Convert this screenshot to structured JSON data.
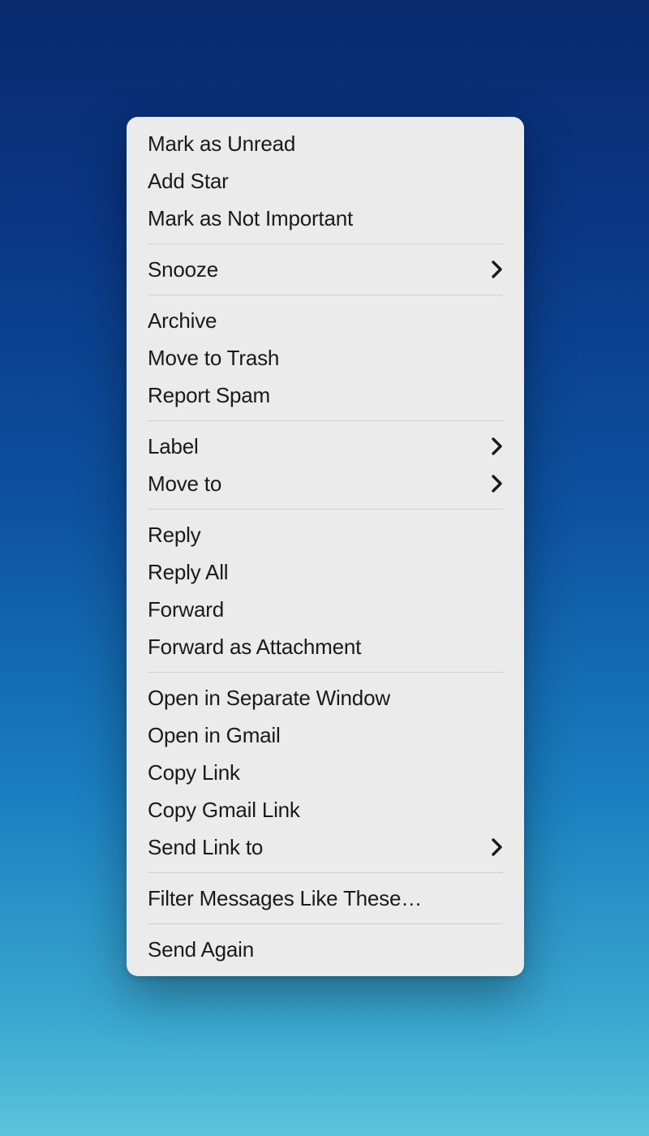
{
  "menu": {
    "groups": [
      [
        {
          "label": "Mark as Unread",
          "submenu": false
        },
        {
          "label": "Add Star",
          "submenu": false
        },
        {
          "label": "Mark as Not Important",
          "submenu": false
        }
      ],
      [
        {
          "label": "Snooze",
          "submenu": true
        }
      ],
      [
        {
          "label": "Archive",
          "submenu": false
        },
        {
          "label": "Move to Trash",
          "submenu": false
        },
        {
          "label": "Report Spam",
          "submenu": false
        }
      ],
      [
        {
          "label": "Label",
          "submenu": true
        },
        {
          "label": "Move to",
          "submenu": true
        }
      ],
      [
        {
          "label": "Reply",
          "submenu": false
        },
        {
          "label": "Reply All",
          "submenu": false
        },
        {
          "label": "Forward",
          "submenu": false
        },
        {
          "label": "Forward as Attachment",
          "submenu": false
        }
      ],
      [
        {
          "label": "Open in Separate Window",
          "submenu": false
        },
        {
          "label": "Open in Gmail",
          "submenu": false
        },
        {
          "label": "Copy Link",
          "submenu": false
        },
        {
          "label": "Copy Gmail Link",
          "submenu": false
        },
        {
          "label": "Send Link to",
          "submenu": true
        }
      ],
      [
        {
          "label": "Filter Messages Like These…",
          "submenu": false
        }
      ],
      [
        {
          "label": "Send Again",
          "submenu": false
        }
      ]
    ]
  }
}
